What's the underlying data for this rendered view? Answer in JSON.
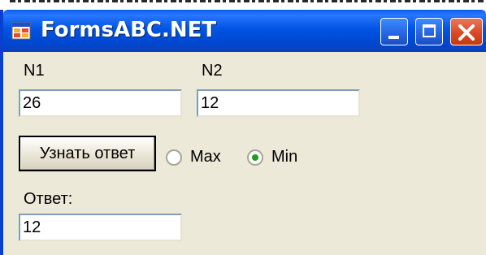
{
  "window": {
    "title": "FormsABC.NET"
  },
  "fields": {
    "n1_label": "N1",
    "n1_value": "26",
    "n2_label": "N2",
    "n2_value": "12"
  },
  "action": {
    "button_label": "Узнать ответ"
  },
  "mode": {
    "options": [
      {
        "label": "Max",
        "selected": false
      },
      {
        "label": "Min",
        "selected": true
      }
    ]
  },
  "result": {
    "label": "Ответ:",
    "value": "12"
  },
  "colors": {
    "titlebar": "#0054e3",
    "window_bg": "#ece9d8",
    "close_button": "#d9461f"
  },
  "icons": {
    "app": "forms-app-icon",
    "minimize": "minimize-icon",
    "maximize": "maximize-icon",
    "close": "close-icon"
  }
}
